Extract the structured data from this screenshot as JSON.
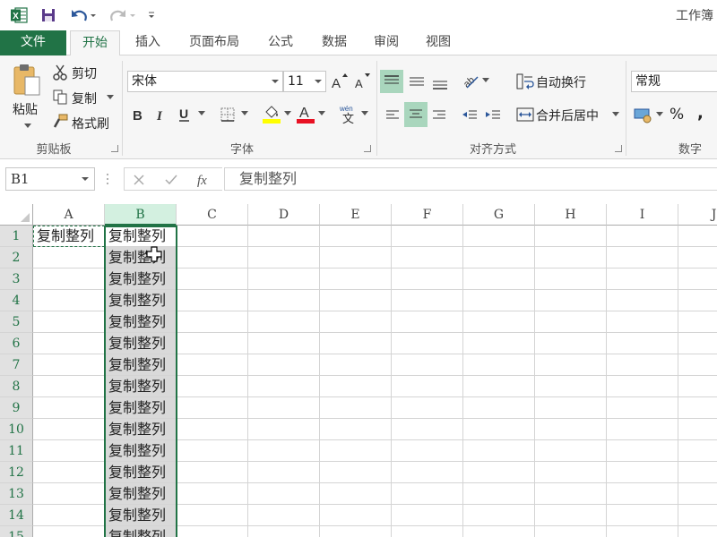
{
  "window": {
    "title": "工作簿"
  },
  "tabs": [
    "文件",
    "开始",
    "插入",
    "页面布局",
    "公式",
    "数据",
    "审阅",
    "视图"
  ],
  "ribbon": {
    "clipboard": {
      "paste": "粘贴",
      "cut": "剪切",
      "copy": "复制",
      "format_painter": "格式刷",
      "label": "剪贴板"
    },
    "font": {
      "font_name": "宋体",
      "font_size": "11",
      "label": "字体"
    },
    "alignment": {
      "wrap_text": "自动换行",
      "merge_center": "合并后居中",
      "label": "对齐方式"
    },
    "number": {
      "format": "常规",
      "percent": "%",
      "comma": ",",
      "label": "数字"
    }
  },
  "formula_bar": {
    "name_box": "B1",
    "content": "复制整列"
  },
  "grid": {
    "columns": [
      "A",
      "B",
      "C",
      "D",
      "E",
      "F",
      "G",
      "H",
      "I",
      "J"
    ],
    "rows": [
      "1",
      "2",
      "3",
      "4",
      "5",
      "6",
      "7",
      "8",
      "9",
      "10",
      "11",
      "12",
      "13",
      "14",
      "15"
    ],
    "selected_column": "B",
    "cell_text": "复制整列",
    "a1": "复制整列"
  },
  "colors": {
    "accent": "#217346",
    "selection_fill": "#d9d9d9",
    "align_highlight": "#a9d6bd",
    "font_color": "#e81123",
    "highlight_color": "#ffff00"
  }
}
